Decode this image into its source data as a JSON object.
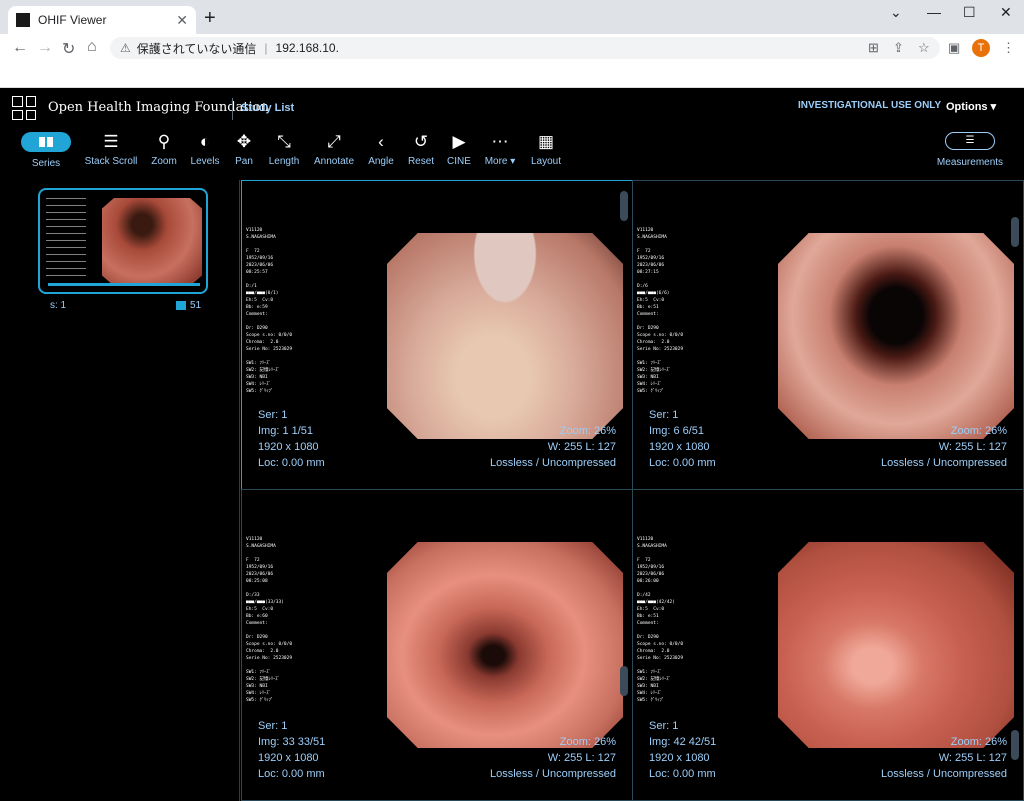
{
  "browser": {
    "tab_title": "OHIF Viewer",
    "tab_close": "✕",
    "new_tab": "+",
    "win_min": "⌄",
    "win_minimize": "—",
    "win_restore": "☐",
    "win_close": "✕",
    "back": "←",
    "forward": "→",
    "reload": "↻",
    "home": "⌂",
    "security_icon": "⚠",
    "security_text": "保護されていない通信",
    "url": "192.168.10.",
    "avatar_letter": "T"
  },
  "header": {
    "title": "Open Health Imaging Foundation",
    "study_list": "Study List",
    "investigational": "INVESTIGATIONAL USE ONLY",
    "options": "Options"
  },
  "toolbar": {
    "series": "Series",
    "stack_scroll": "Stack Scroll",
    "zoom": "Zoom",
    "levels": "Levels",
    "pan": "Pan",
    "length": "Length",
    "annotate": "Annotate",
    "angle": "Angle",
    "reset": "Reset",
    "cine": "CINE",
    "more": "More",
    "layout": "Layout",
    "measurements": "Measurements"
  },
  "sidebar": {
    "series_label": "s: 1",
    "image_count": "51"
  },
  "viewports": [
    {
      "ser": "Ser: 1",
      "img": "Img: 1 1/51",
      "size": "1920 x 1080",
      "loc": "Loc: 0.00 mm",
      "zoom": "Zoom: 26%",
      "wl": "W: 255 L: 127",
      "compression": "Lossless / Uncompressed"
    },
    {
      "ser": "Ser: 1",
      "img": "Img: 6 6/51",
      "size": "1920 x 1080",
      "loc": "Loc: 0.00 mm",
      "zoom": "Zoom: 26%",
      "wl": "W: 255 L: 127",
      "compression": "Lossless / Uncompressed"
    },
    {
      "ser": "Ser: 1",
      "img": "Img: 33 33/51",
      "size": "1920 x 1080",
      "loc": "Loc: 0.00 mm",
      "zoom": "Zoom: 26%",
      "wl": "W: 255 L: 127",
      "compression": "Lossless / Uncompressed"
    },
    {
      "ser": "Ser: 1",
      "img": "Img: 42 42/51",
      "size": "1920 x 1080",
      "loc": "Loc: 0.00 mm",
      "zoom": "Zoom: 26%",
      "wl": "W: 255 L: 127",
      "compression": "Lossless / Uncompressed"
    }
  ]
}
